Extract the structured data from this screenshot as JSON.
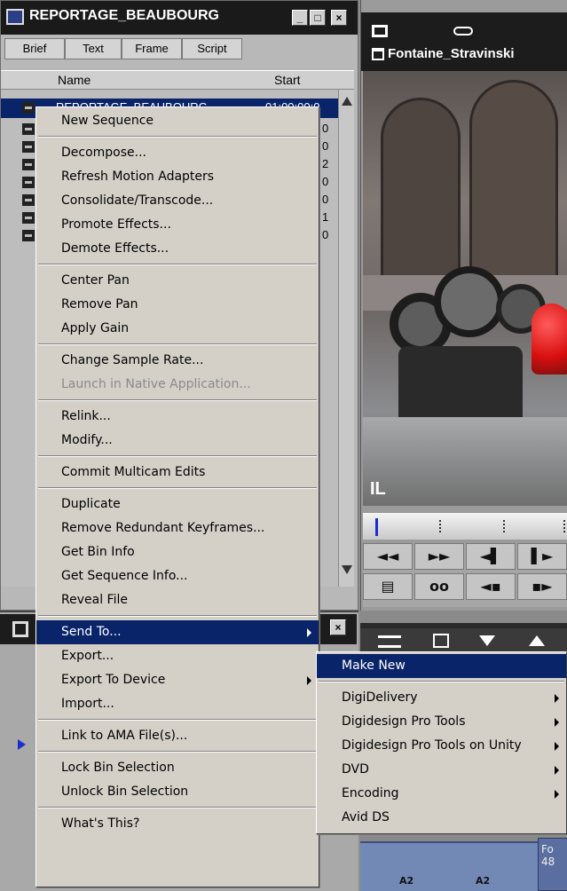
{
  "bin_window": {
    "title": "REPORTAGE_BEAUBOURG",
    "min": "_",
    "max": "□",
    "close": "×",
    "tabs": [
      "Brief",
      "Text",
      "Frame",
      "Script"
    ],
    "columns": {
      "name": "Name",
      "start": "Start"
    },
    "first_row": {
      "name": "REPORTAGE_BEAUBOURG",
      "start": "01:00:00:0"
    },
    "start_fragments": [
      "0",
      "0",
      "2",
      "0",
      "0",
      "1",
      "0"
    ]
  },
  "monitor": {
    "clip_name": "Fontaine_Stravinski",
    "overlay_label": "IL",
    "transport_row1": [
      "◄◄",
      "►►",
      "◄▌",
      "▌►"
    ],
    "transport_row2": [
      "▤",
      "oo",
      "◄▪",
      "▪►"
    ],
    "track_labels": [
      "A2",
      "A2"
    ],
    "corner_text": "Fo\n48"
  },
  "context_menu": {
    "groups": [
      [
        "New Sequence"
      ],
      [
        "Decompose...",
        "Refresh Motion Adapters",
        "Consolidate/Transcode...",
        "Promote Effects...",
        "Demote Effects..."
      ],
      [
        "Center Pan",
        "Remove Pan",
        "Apply Gain"
      ],
      [
        "Change Sample Rate...",
        "Launch in Native Application..."
      ],
      [
        "Relink...",
        "Modify..."
      ],
      [
        "Commit Multicam Edits"
      ],
      [
        "Duplicate",
        "Remove Redundant Keyframes...",
        "Get Bin Info",
        "Get Sequence Info...",
        "Reveal File"
      ],
      [
        "Send To...",
        "Export...",
        "Export To Device",
        "Import..."
      ],
      [
        "Link to AMA File(s)..."
      ],
      [
        "Lock Bin Selection",
        "Unlock Bin Selection"
      ],
      [
        "What's This?"
      ]
    ],
    "disabled": [
      "Launch in Native Application..."
    ],
    "selected": "Send To...",
    "with_submenu": [
      "Send To...",
      "Export To Device"
    ]
  },
  "submenu": {
    "items": [
      "Make New",
      "DigiDelivery",
      "Digidesign Pro Tools",
      "Digidesign Pro Tools on Unity",
      "DVD",
      "Encoding",
      "Avid DS"
    ],
    "selected": "Make New",
    "with_arrow": [
      "DigiDelivery",
      "Digidesign Pro Tools",
      "Digidesign Pro Tools on Unity",
      "DVD",
      "Encoding"
    ]
  },
  "colors": {
    "selection": "#0a246a",
    "menu_bg": "#d4d0c8",
    "title_bg": "#1a1a1a"
  }
}
